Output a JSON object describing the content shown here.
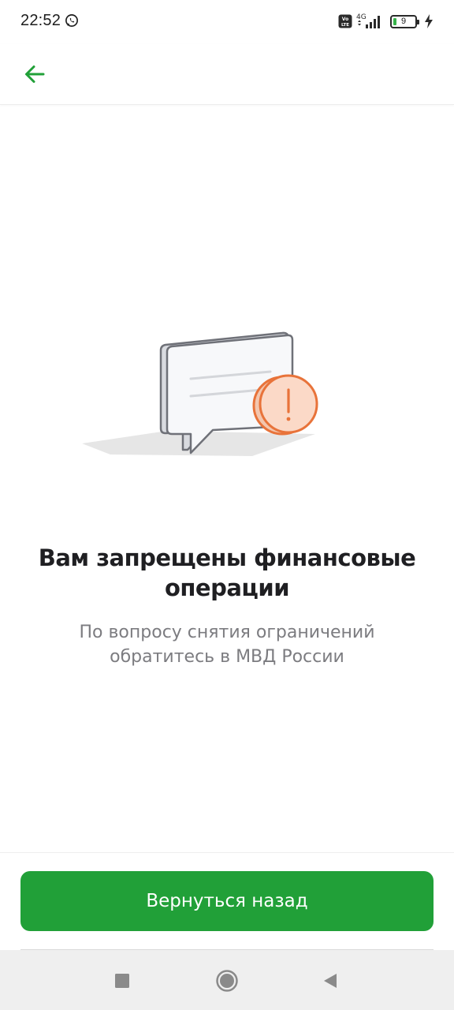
{
  "status_bar": {
    "time": "22:52",
    "battery_level": "9",
    "network": "4G",
    "icons": [
      "whatsapp-icon",
      "volte-icon",
      "signal-icon",
      "battery-icon",
      "charging-icon"
    ]
  },
  "app_bar": {
    "back_icon": "arrow-left-icon",
    "accent_color": "#21a038"
  },
  "illustration": {
    "name": "blocked-message-illustration",
    "accent_color": "#e8733a"
  },
  "message": {
    "title": "Вам запрещены финансовые операции",
    "subtitle": "По вопросу снятия ограничений обратитесь в МВД России"
  },
  "actions": {
    "back_button_label": "Вернуться назад",
    "button_color": "#21a038"
  },
  "nav_bar": {
    "recents_icon": "square-icon",
    "home_icon": "circle-icon",
    "back_icon": "triangle-back-icon"
  }
}
